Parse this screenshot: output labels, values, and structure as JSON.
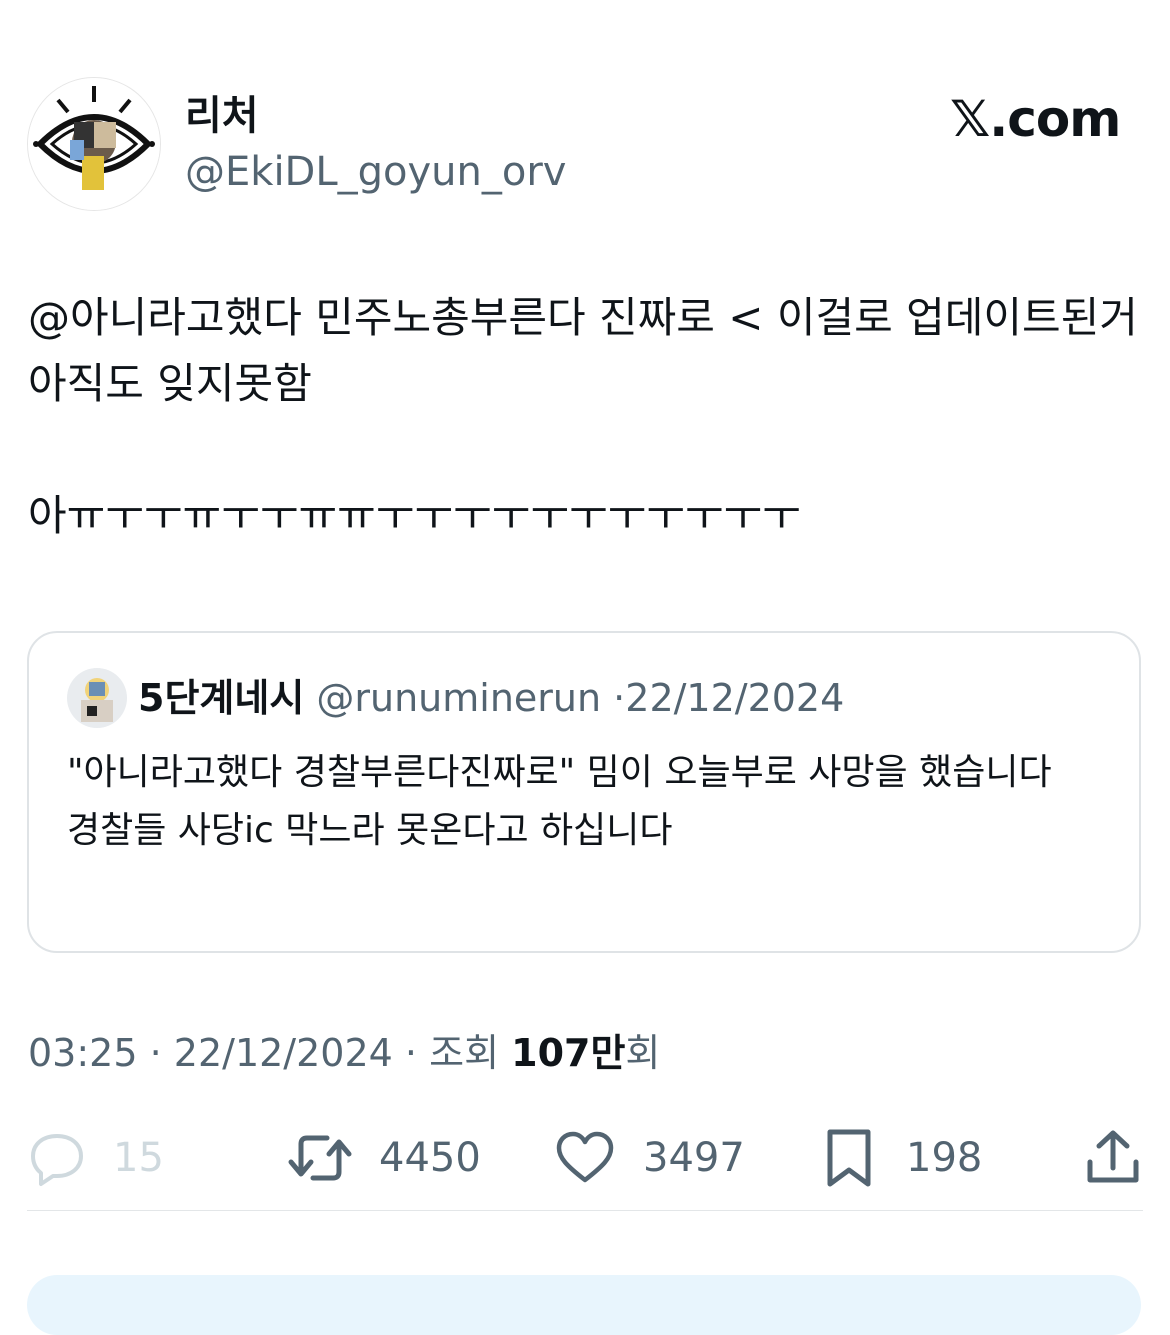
{
  "header": {
    "display_name": "리처",
    "handle": "@EkiDL_goyun_orv",
    "brand": "𝕏.com"
  },
  "tweet": {
    "text": "@아니라고했다 민주노총부른다 진짜로 < 이걸로 업데이트된거 아직도 잊지못함\n\n아ㅠㅜㅜㅠㅜㅜㅠㅠㅜㅜㅜㅜㅜㅜㅜㅜㅜㅜㅜ"
  },
  "quote": {
    "name": "5단계네시",
    "handle": "@runuminerun",
    "separator": "·",
    "date": "22/12/2024",
    "text": "\"아니라고했다 경찰부른다진짜로\" 밈이 오늘부로 사망을 했습니다\n경찰들 사당ic 막느라 못온다고 하십니다"
  },
  "meta": {
    "time": "03:25",
    "sep1": "·",
    "date": "22/12/2024",
    "sep2": "·",
    "views_label": "조회",
    "views_count": "107만",
    "views_suffix": "회"
  },
  "actions": {
    "reply_icon": "reply-icon",
    "reply_count": "15",
    "retweet_icon": "retweet-icon",
    "retweet_count": "4450",
    "like_icon": "heart-icon",
    "like_count": "3497",
    "bookmark_icon": "bookmark-icon",
    "bookmark_count": "198",
    "share_icon": "share-icon"
  },
  "colors": {
    "text": "#0f1419",
    "secondary": "#536471",
    "border": "#dfe3e6",
    "faded": "#cfd9de"
  }
}
